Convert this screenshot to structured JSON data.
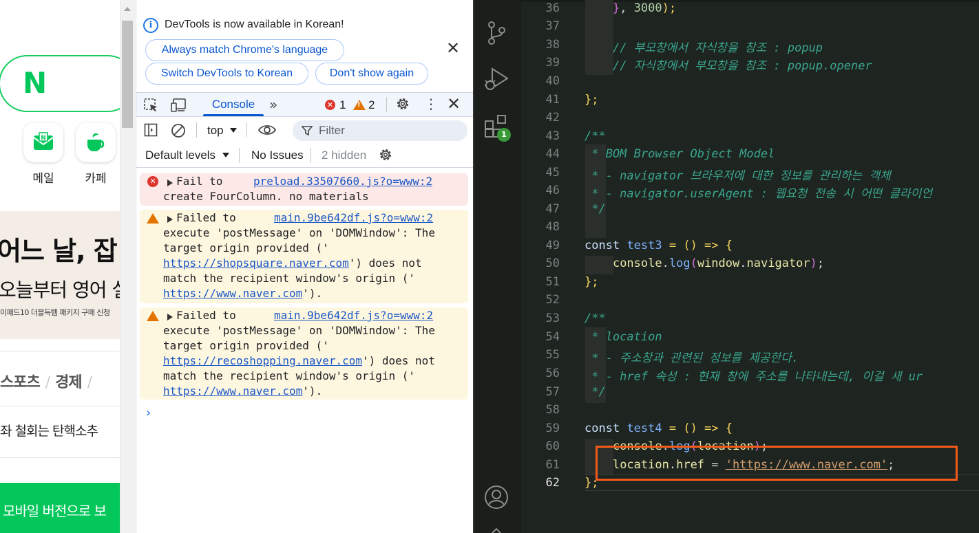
{
  "naver": {
    "logo": "N",
    "services": [
      {
        "label": "메일",
        "icon": "mail-icon"
      },
      {
        "label": "카페",
        "icon": "cafe-icon"
      }
    ],
    "banner_line1": "어느 날, 잡",
    "banner_line2": "오늘부터 영어 실",
    "banner_line3": "이패드10 더블득템 패키지 구매 신청",
    "news_tabs": [
      "스포츠",
      "경제"
    ],
    "news_headline": "좌 철회는 탄핵소추",
    "mobile_button": "모바일 버전으로 보"
  },
  "devtools": {
    "banner": {
      "text": "DevTools is now available in Korean!",
      "btn_match": "Always match Chrome's language",
      "btn_switch": "Switch DevTools to Korean",
      "btn_dont_show": "Don't show again"
    },
    "tabs": {
      "console": "Console",
      "more": "»"
    },
    "error_count": "1",
    "warning_count": "2",
    "context": "top",
    "filter_placeholder": "Filter",
    "levels": "Default levels",
    "issues": "No Issues",
    "hidden": "2 hidden",
    "messages": [
      {
        "level": "error",
        "source": "preload.33507660.js?o=www:2",
        "lines": [
          "Fail to",
          "create FourColumn. no materials"
        ]
      },
      {
        "level": "warning",
        "source": "main.9be642df.js?o=www:2",
        "lines": [
          "Failed to",
          "execute 'postMessage' on 'DOMWindow': The",
          "target origin provided ('",
          "') does not",
          "match the recipient window's origin ('",
          "')."
        ],
        "target_url": "https://shopsquare.naver.com",
        "origin_url": "https://www.naver.com"
      },
      {
        "level": "warning",
        "source": "main.9be642df.js?o=www:2",
        "lines": [
          "Failed to",
          "execute 'postMessage' on 'DOMWindow': The",
          "target origin provided ('",
          "') does not",
          "match the recipient window's origin ('",
          "')."
        ],
        "target_url": "https://recoshopping.naver.com",
        "origin_url": "https://www.naver.com"
      }
    ],
    "prompt": "›"
  },
  "vscode": {
    "activity_badge": "1",
    "line_numbers": [
      "36",
      "37",
      "38",
      "39",
      "40",
      "41",
      "42",
      "43",
      "44",
      "45",
      "46",
      "47",
      "48",
      "49",
      "50",
      "51",
      "52",
      "53",
      "54",
      "55",
      "56",
      "57",
      "58",
      "59",
      "60",
      "61",
      "62"
    ],
    "code": {
      "l36_close": "}",
      "l36_sep": ", ",
      "l36_num": "3000",
      "l36_end": ");",
      "l38": "// 부모창에서 자식창을 참조 : popup",
      "l39": "// 자식창에서 부모창을 참조 : popup.opener",
      "l41": "};",
      "l43": "/**",
      "l44": " * BOM Browser Object Model",
      "l45": " * - navigator 브라우저에 대한 정보를 관리하는 객체",
      "l46": " * - navigator.userAgent : 웹요청 전송 시 어떤 클라이언",
      "l47": " */",
      "l49_kw": "const",
      "l49_name": "test3",
      "l49_rest": " = () => {",
      "l50_obj": "console",
      "l50_fn": "log",
      "l50_arg1": "window",
      "l50_arg2": "navigator",
      "l51": "};",
      "l53": "/**",
      "l54": " * location",
      "l55": " * - 주소창과 관련된 정보를 제공한다.",
      "l56": " * - href 속성 : 현재 창에 주소를 나타내는데, 이걸 새 ur",
      "l57": " */",
      "l59_kw": "const",
      "l59_name": "test4",
      "l59_rest": " = () => {",
      "l60_obj": "console",
      "l60_fn": "log",
      "l60_arg": "location",
      "l61_obj": "location",
      "l61_prop": "href",
      "l61_str": "'https://www.naver.com'",
      "l62": "};"
    }
  },
  "colors": {
    "naver_green": "#03c75a",
    "devtools_blue": "#0b57d0",
    "error_red": "#dc362e",
    "warning_orange": "#e37400",
    "vscode_bg": "#1e2420",
    "highlight_orange": "#f25a1a"
  }
}
